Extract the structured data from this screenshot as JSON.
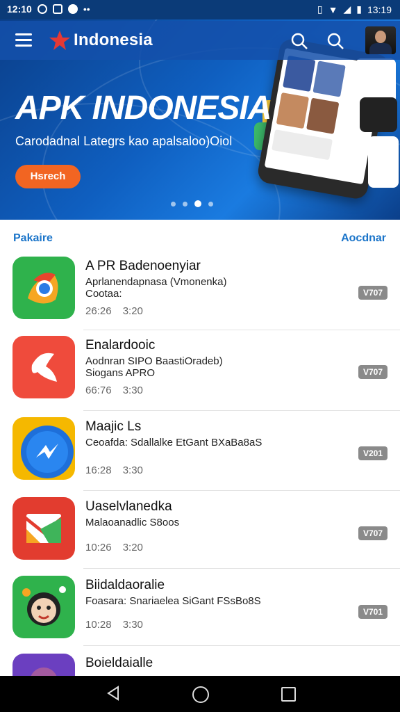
{
  "status_bar": {
    "time_left": "12:10",
    "time_right": "13:19"
  },
  "header": {
    "brand": "Indonesia"
  },
  "hero": {
    "title": "APK INDONESIA",
    "subtitle": "Carodadnal Lategrs kao apalsaloo)Oiol",
    "button": "Hsrech",
    "slide_index": 3,
    "slide_count": 4
  },
  "section": {
    "left_label": "Pakaire",
    "right_label": "Aocdnar"
  },
  "apps": [
    {
      "title": "A PR Badenoenyiar",
      "line1": "Aprlanendapnasa (Vmonenka)",
      "line2": "Cootaa:",
      "meta": "26:26 3:20",
      "badge": "V707",
      "icon": "chrome-style-icon"
    },
    {
      "title": "Enalardooic",
      "line1": "Aodnran SIPO BaastiOradeb)",
      "line2": "Siogans APRO",
      "meta": "66:76 3:30",
      "badge": "V707",
      "icon": "bird-icon"
    },
    {
      "title": "Maajic Ls",
      "line1": "Ceoafda: Sdallalke EtGant BXaBa8aS",
      "line2": "",
      "meta": "16:28 3:30",
      "badge": "V201",
      "icon": "messenger-icon"
    },
    {
      "title": "Uaselvlanedka",
      "line1": "Malaoanadlic S8oos",
      "line2": "",
      "meta": "10:26 3:20",
      "badge": "V707",
      "icon": "mail-icon"
    },
    {
      "title": "Biidaldaoralie",
      "line1": "Foasara: Snariaelea SiGant FSsBo8S",
      "line2": "",
      "meta": "10:28 3:30",
      "badge": "V701",
      "icon": "character-icon"
    },
    {
      "title": "Boieldaialle",
      "line1": "",
      "line2": "",
      "meta": "",
      "badge": "",
      "icon": "purple-app-icon"
    }
  ]
}
